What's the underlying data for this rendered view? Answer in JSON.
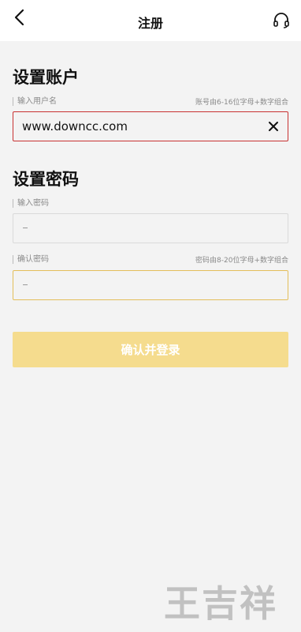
{
  "header": {
    "title": "注册",
    "back_icon": "chevron-left-icon",
    "support_icon": "headset-icon"
  },
  "account": {
    "section_title": "设置账户",
    "username_label": "输入用户名",
    "username_hint": "账号由6-16位字母+数字组合",
    "username_value": "www.downcc.com",
    "clear_icon": "close-icon"
  },
  "password": {
    "section_title": "设置密码",
    "password_label": "输入密码",
    "password_value": "",
    "confirm_label": "确认密码",
    "confirm_hint": "密码由8-20位字母+数字组合",
    "confirm_value": ""
  },
  "submit": {
    "label": "确认并登录"
  },
  "watermark": {
    "text": "王吉祥"
  },
  "colors": {
    "accent": "#f5dc8e",
    "error_border": "#c83232",
    "focus_border": "#e4be5a"
  }
}
